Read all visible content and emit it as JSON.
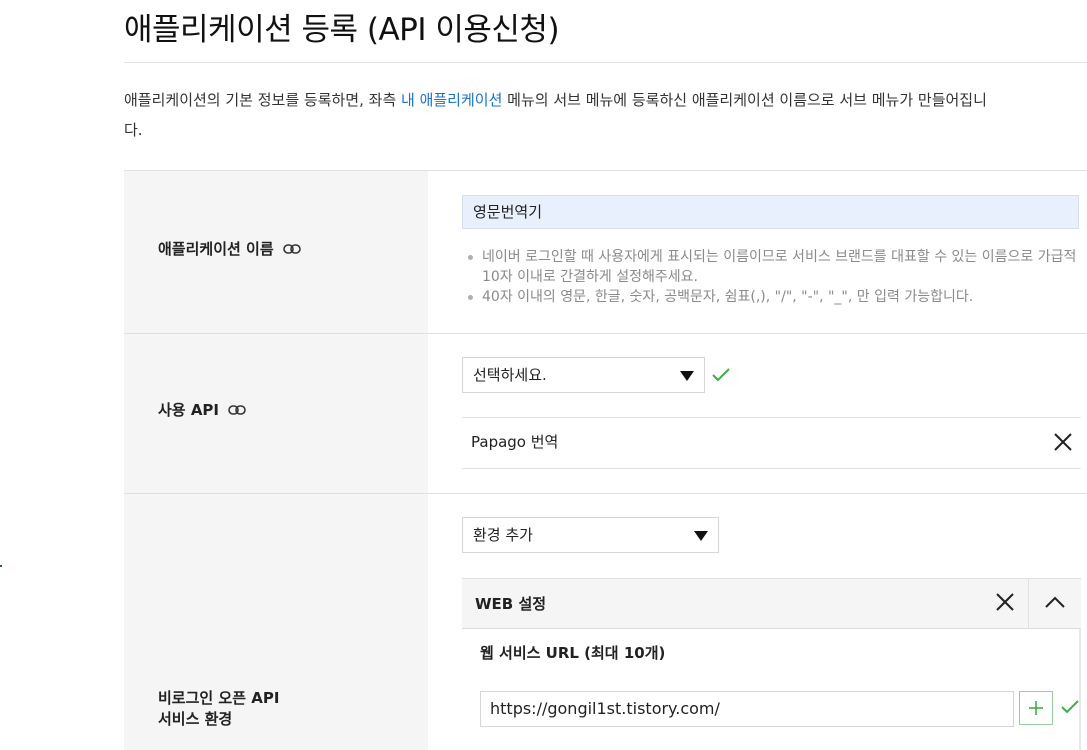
{
  "page": {
    "title": "애플리케이션 등록 (API 이용신청)",
    "description_parts": {
      "before_link": "애플리케이션의 기본 정보를 등록하면, 좌측 ",
      "link": "내 애플리케이션",
      "after_link": " 메뉴의 서브 메뉴에 등록하신 애플리케이션 이름으로 서브 메뉴가 만들어집니",
      "line2": "다."
    }
  },
  "app_name": {
    "label": "애플리케이션 이름",
    "link_icon": "link-icon",
    "value": "영문번역기",
    "hints": [
      "네이버 로그인할 때 사용자에게 표시되는 이름이므로 서비스 브랜드를 대표할 수 있는 이름으로 가급적 10자 이내로 간결하게 설정해주세요.",
      "40자 이내의 영문, 한글, 숫자, 공백문자, 쉼표(,), \"/\", \"-\", \"_\", 만 입력 가능합니다."
    ]
  },
  "api": {
    "label": "사용 API",
    "link_icon": "link-icon",
    "select_value": "선택하세요.",
    "selected_items": [
      {
        "label": "Papago 번역",
        "remove_icon": "close-icon"
      }
    ],
    "status_icon": "check-icon"
  },
  "environment": {
    "label_line1": "비로그인 오픈 API",
    "label_line2": "서비스 환경",
    "select_value": "환경 추가",
    "panels": [
      {
        "title": "WEB 설정",
        "remove_icon": "close-icon",
        "collapse_icon": "chevron-up-icon",
        "field_label": "웹 서비스 URL (최대 10개)",
        "url_value": "https://gongil1st.tistory.com/",
        "add_icon": "plus-icon",
        "status_icon": "check-icon"
      }
    ]
  },
  "colors": {
    "link": "#1a73c8",
    "check": "#3fae4a",
    "input_filled_bg": "#e9f0fd",
    "label_bg": "#f5f5f5"
  }
}
